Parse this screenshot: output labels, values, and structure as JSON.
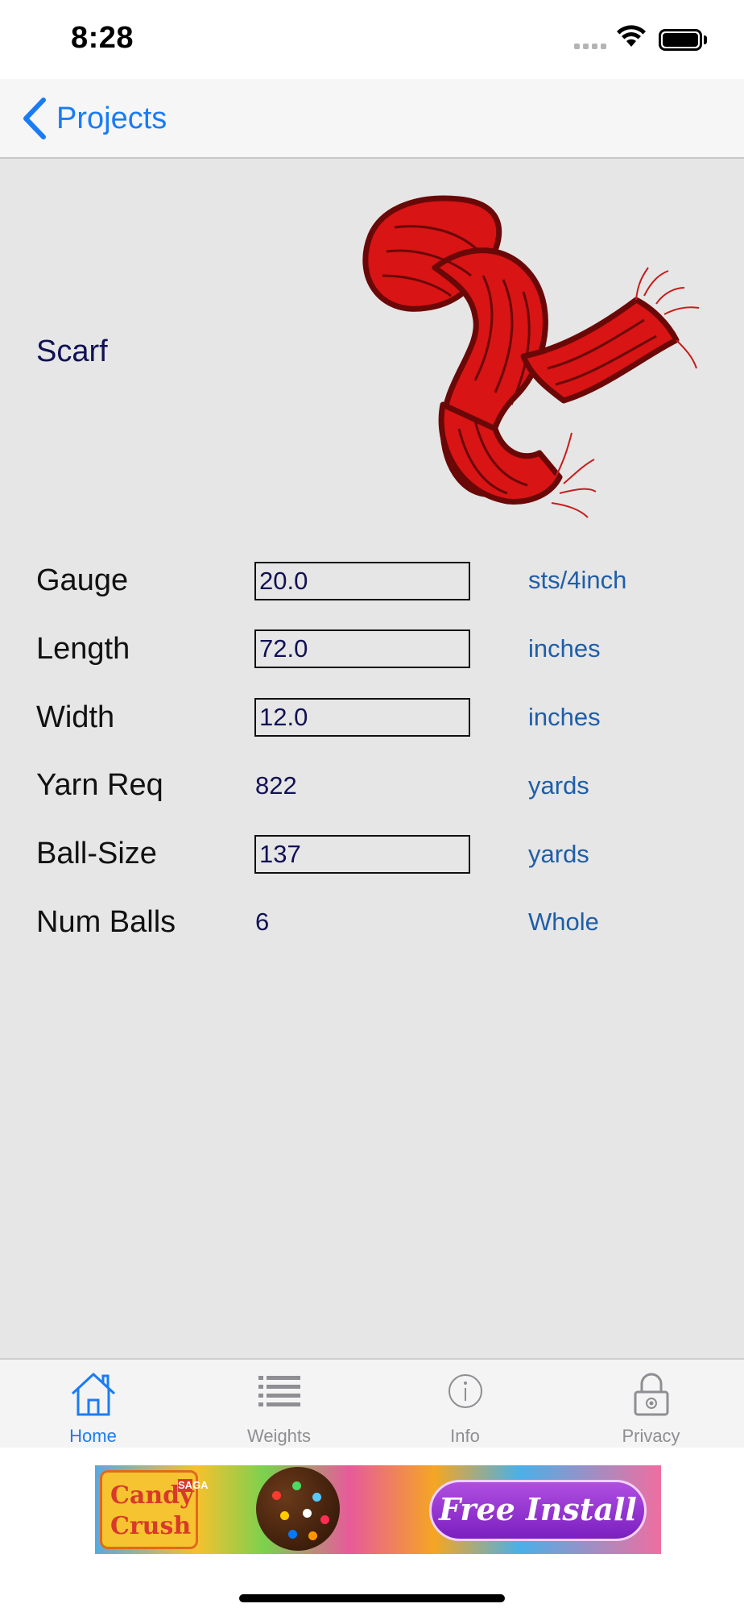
{
  "status_bar": {
    "time": "8:28"
  },
  "nav": {
    "back_label": "Projects"
  },
  "project": {
    "name": "Scarf"
  },
  "rows": [
    {
      "label": "Gauge",
      "value": "20.0",
      "unit": "sts/4inch",
      "editable": true
    },
    {
      "label": "Length",
      "value": "72.0",
      "unit": "inches",
      "editable": true
    },
    {
      "label": "Width",
      "value": "12.0",
      "unit": "inches",
      "editable": true
    },
    {
      "label": "Yarn Req",
      "value": "822",
      "unit": "yards",
      "editable": false
    },
    {
      "label": "Ball-Size",
      "value": "137",
      "unit": "yards",
      "editable": true
    },
    {
      "label": "Num Balls",
      "value": "6",
      "unit": "Whole",
      "editable": false
    }
  ],
  "tabs": [
    {
      "label": "Home",
      "icon": "home-icon",
      "active": true
    },
    {
      "label": "Weights",
      "icon": "list-icon",
      "active": false
    },
    {
      "label": "Info",
      "icon": "info-icon",
      "active": false
    },
    {
      "label": "Privacy",
      "icon": "lock-icon",
      "active": false
    }
  ],
  "ad": {
    "brand_line1": "Candy",
    "brand_line2": "Crush",
    "brand_tag": "SAGA",
    "cta": "Free Install"
  },
  "colors": {
    "accent": "#1a7cf5",
    "content_bg": "#e6e6e6",
    "unit_text": "#1f5ea8",
    "value_text": "#111155",
    "scarf": "#d81414"
  }
}
